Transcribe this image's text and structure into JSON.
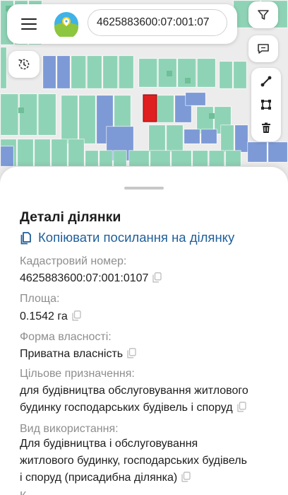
{
  "search": {
    "value": "4625883600:07:001:07"
  },
  "details": {
    "title": "Деталі ділянки",
    "copy_link": "Копіювати посилання на ділянку",
    "cadastral_label": "Кадастровий номер:",
    "cadastral_value": "4625883600:07:001:0107",
    "area_label": "Площа:",
    "area_value": "0.1542 га",
    "ownership_label": "Форма власності:",
    "ownership_value": "Приватна власність",
    "purpose_label": "Цільове призначення:",
    "purpose_line1": "для будівництва обслуговування житлового",
    "purpose_line2": "будинку господарських будівель і споруд",
    "usage_label": "Вид використання:",
    "usage_line1": "Для будівництва і обслуговування",
    "usage_line2": "житлового будинку, господарських будівель",
    "usage_line3": "і споруд (присадибна ділянка)",
    "next_label_partial": "К"
  },
  "colors": {
    "parcel_private": "#8fd3b6",
    "parcel_other": "#7d9ad6",
    "parcel_selected": "#e02020",
    "link": "#1f5f9a",
    "muted_text": "#8e8e8e"
  },
  "icons": {
    "menu": "hamburger-icon",
    "logo": "app-logo",
    "filter": "filter-icon",
    "feedback": "chat-icon",
    "history": "history-icon",
    "measure": "ruler-line-icon",
    "area": "polygon-area-icon",
    "delete": "trash-icon",
    "copy": "copy-icon"
  }
}
